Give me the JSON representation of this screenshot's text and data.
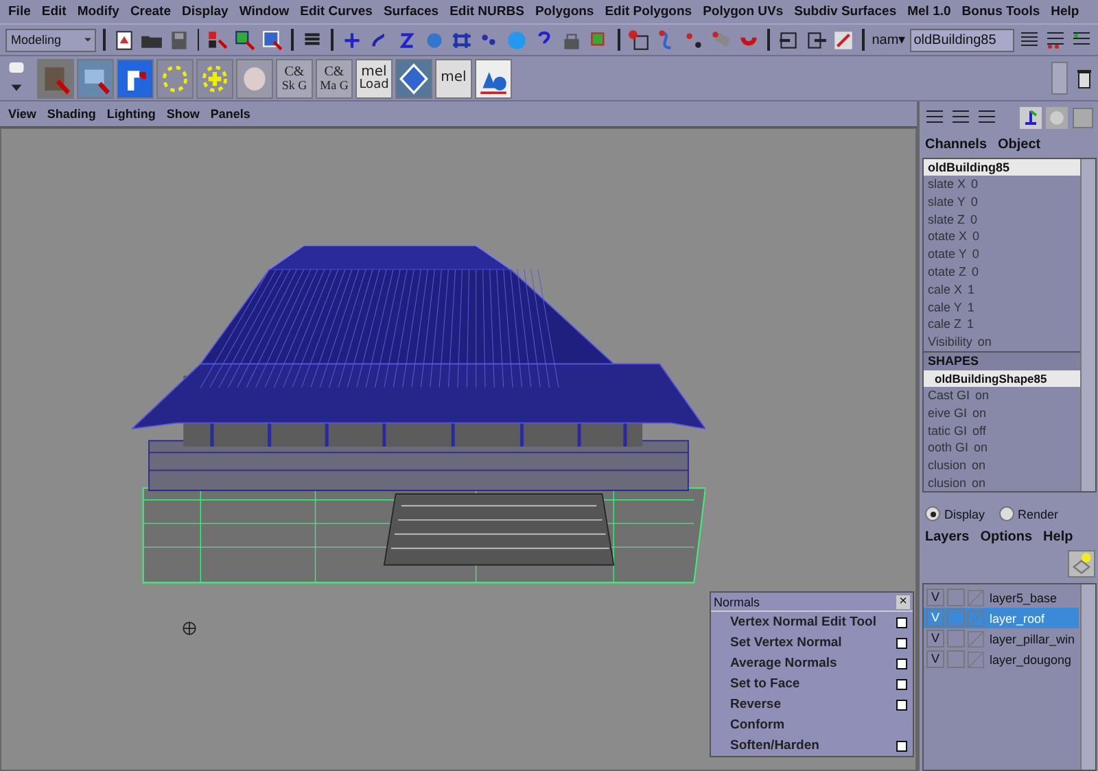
{
  "menu_bar": [
    "File",
    "Edit",
    "Modify",
    "Create",
    "Display",
    "Window",
    "Edit Curves",
    "Surfaces",
    "Edit NURBS",
    "Polygons",
    "Edit Polygons",
    "Polygon UVs",
    "Subdiv Surfaces",
    "Mel 1.0",
    "Bonus Tools",
    "Help"
  ],
  "status_line": {
    "mode": "Modeling",
    "name_label": "nam▾",
    "name_field": "oldBuilding85"
  },
  "shelf": [
    {
      "kind": "icon"
    },
    {
      "kind": "icon"
    },
    {
      "kind": "icon"
    },
    {
      "kind": "icon"
    },
    {
      "kind": "icon"
    },
    {
      "kind": "icon"
    },
    {
      "kind": "text",
      "top": "C&",
      "bottom": "Sk G"
    },
    {
      "kind": "text",
      "top": "C&",
      "bottom": "Ma G"
    },
    {
      "kind": "text",
      "top": "mel",
      "bottom": "Load"
    },
    {
      "kind": "icon"
    },
    {
      "kind": "text",
      "top": "mel"
    },
    {
      "kind": "icon"
    }
  ],
  "panel_menu": [
    "View",
    "Shading",
    "Lighting",
    "Show",
    "Panels"
  ],
  "channel_box": {
    "menus": [
      "Channels",
      "Object"
    ],
    "object_name": "oldBuilding85",
    "channels": [
      {
        "name": "slate X",
        "value": "0"
      },
      {
        "name": "slate Y",
        "value": "0"
      },
      {
        "name": "slate Z",
        "value": "0"
      },
      {
        "name": "otate X",
        "value": "0"
      },
      {
        "name": "otate Y",
        "value": "0"
      },
      {
        "name": "otate Z",
        "value": "0"
      },
      {
        "name": "cale X",
        "value": "1"
      },
      {
        "name": "cale Y",
        "value": "1"
      },
      {
        "name": "cale Z",
        "value": "1"
      },
      {
        "name": "Visibility",
        "value": "on"
      }
    ],
    "shapes_heading": "SHAPES",
    "shape_name": "oldBuildingShape85",
    "shape_channels": [
      {
        "name": "Cast GI",
        "value": "on"
      },
      {
        "name": "eive GI",
        "value": "on"
      },
      {
        "name": "tatic GI",
        "value": "off"
      },
      {
        "name": "ooth GI",
        "value": "on"
      },
      {
        "name": "clusion",
        "value": "on"
      },
      {
        "name": "clusion",
        "value": "on"
      }
    ]
  },
  "layer_editor": {
    "modes": [
      {
        "label": "Display",
        "selected": true
      },
      {
        "label": "Render",
        "selected": false
      }
    ],
    "menus": [
      "Layers",
      "Options",
      "Help"
    ],
    "layers": [
      {
        "name": "layer5_base",
        "visibility_toggle": "V",
        "visible": true,
        "selected": false
      },
      {
        "name": "layer_roof",
        "visibility_toggle": "V",
        "visible": true,
        "selected": true
      },
      {
        "name": "layer_pillar_win",
        "visibility_toggle": "V",
        "visible": true,
        "selected": false
      },
      {
        "name": "layer_dougong",
        "visibility_toggle": "V",
        "visible": true,
        "selected": false
      }
    ]
  },
  "normals_menu": {
    "title": "Normals",
    "close": "×",
    "items": [
      {
        "label": "Vertex Normal Edit Tool",
        "option_box": true
      },
      {
        "label": "Set Vertex Normal",
        "option_box": true
      },
      {
        "label": "Average Normals",
        "option_box": true
      },
      {
        "label": "Set to Face",
        "option_box": true
      },
      {
        "label": "Reverse",
        "option_box": true
      },
      {
        "label": "Conform",
        "option_box": false
      },
      {
        "label": "Soften/Harden",
        "option_box": true
      }
    ]
  }
}
